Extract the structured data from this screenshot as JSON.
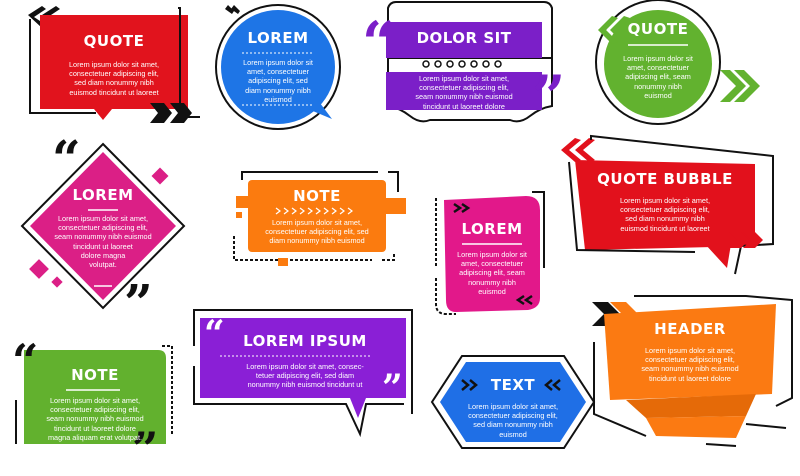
{
  "colors": {
    "red": "#e1131d",
    "blue": "#1e75e6",
    "purple": "#7b1fc8",
    "green": "#62b22f",
    "magenta": "#db1f86",
    "orange": "#fb7b0f",
    "purple2": "#8a1fd6",
    "pink": "#e2188a",
    "red2": "#e2111c",
    "orange2": "#fb7a12",
    "green2": "#62b12e",
    "purple3": "#8b20d8",
    "blue2": "#1f6fe6",
    "outline": "#111111"
  },
  "cards": [
    {
      "id": "quote-red",
      "title": "QUOTE",
      "lines": [
        "Lorem ipsum dolor sit amet,",
        "consectetuer adipiscing elit,",
        "sed diam nonummy nibh",
        "euismod tincidunt ut laoreet"
      ]
    },
    {
      "id": "lorem-blue",
      "title": "LOREM",
      "lines": [
        "Lorem ipsum dolor sit",
        "amet, consectetuer",
        "adipiscing elit, sed",
        "diam nonummy nibh",
        "euismod"
      ]
    },
    {
      "id": "dolor-sit",
      "title": "DOLOR SIT",
      "lines": [
        "Lorem ipsum dolor sit amet,",
        "consectetuer adipiscing elit,",
        "seam nonummy nibh euismod",
        "tincidunt ut laoreet dolore"
      ]
    },
    {
      "id": "quote-green",
      "title": "QUOTE",
      "lines": [
        "Lorem ipsum dolor sit",
        "amet, consectetuer",
        "adipiscing elit, seam",
        "nonummy nibh",
        "euismod"
      ]
    },
    {
      "id": "lorem-diamond",
      "title": "LOREM",
      "lines": [
        "Lorem ipsum dolor sit amet,",
        "consectetuer adipiscing elit,",
        "seam nonummy nibh euismod",
        "tincidunt ut laoreet",
        "dolore magna",
        "volutpat."
      ]
    },
    {
      "id": "note-orange",
      "title": "NOTE",
      "lines": [
        "Lorem ipsum dolor sit amet,",
        "consectetuer adipiscing elit, sed",
        "diam nonummy nibh euismod"
      ]
    },
    {
      "id": "lorem-pink",
      "title": "LOREM",
      "lines": [
        "Lorem ipsum dolor sit",
        "amet, consectetuer",
        "adipiscing elit, seam",
        "nonummy nibh",
        "euismod"
      ]
    },
    {
      "id": "quote-bubble",
      "title": "QUOTE BUBBLE",
      "lines": [
        "Lorem ipsum dolor sit amet,",
        "consectetuer adipiscing elit,",
        "sed diam nonummy nibh",
        "euismod tincidunt ut laoreet"
      ]
    },
    {
      "id": "lorem-ipsum",
      "title": "LOREM IPSUM",
      "lines": [
        "Lorem ipsum dolor sit amet, consec-",
        "tetuer adipiscing elit, sed diam",
        "nonummy nibh euismod tincidunt ut"
      ]
    },
    {
      "id": "header-orange",
      "title": "HEADER",
      "lines": [
        "Lorem ipsum dolor sit amet,",
        "consectetuer adipiscing elit,",
        "seam nonummy nibh euismod",
        "tincidunt ut laoreet dolore"
      ]
    },
    {
      "id": "note-green",
      "title": "NOTE",
      "lines": [
        "Lorem ipsum dolor sit amet,",
        "consectetuer adipiscing elit,",
        "seam nonummy nibh euismod",
        "tincidunt ut laoreet dolore",
        "magna aliquam erat volutpat."
      ]
    },
    {
      "id": "text-hexagon",
      "title": "TEXT",
      "lines": [
        "Lorem ipsum dolor sit amet,",
        "consectetuer adipiscing elit,",
        "sed diam nonummy nibh",
        "euismod"
      ]
    }
  ],
  "glyphs": {
    "open_quote": "“",
    "close_quote": "”",
    "chevrons_left": "«",
    "chevrons_right": "»",
    "quote_mark": "“"
  }
}
